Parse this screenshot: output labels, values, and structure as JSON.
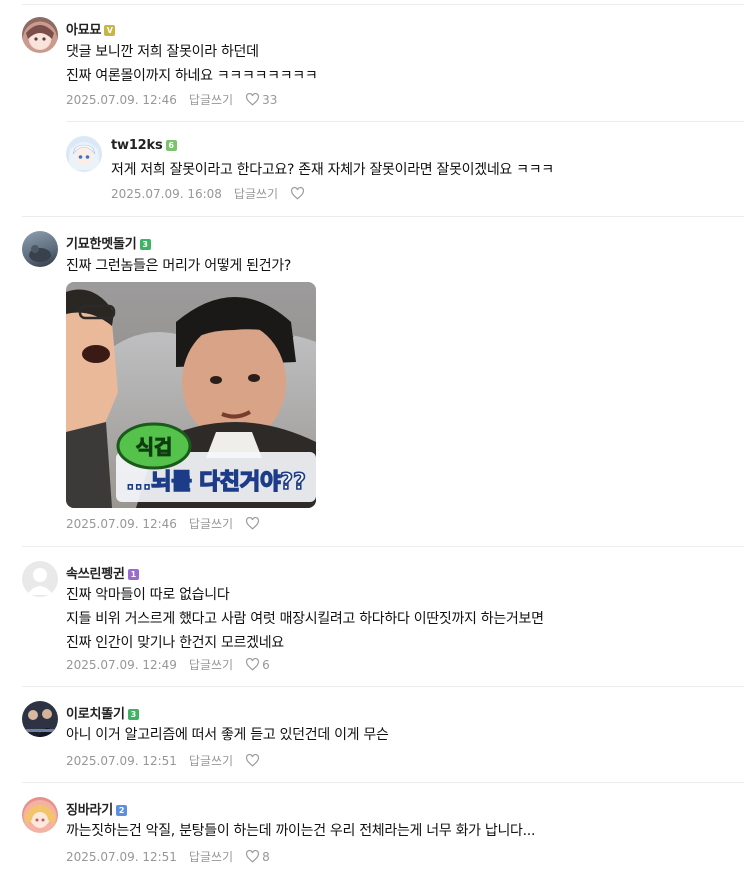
{
  "comments": [
    {
      "nickname": "아묘묘",
      "badge": "V",
      "lines": [
        "댓글 보니깐 저희 잘못이라 하던데",
        "진짜 여론몰이까지 하네요 ㅋㅋㅋㅋㅋㅋㅋㅋ"
      ],
      "date": "2025.07.09. 12:46",
      "reply_label": "답글쓰기",
      "likes": "33"
    },
    {
      "nickname": "tw12ks",
      "badge": "6",
      "lines": [
        "저게 저희 잘못이라고 한다고요? 존재 자체가 잘못이라면 잘못이겠네요 ㅋㅋㅋ"
      ],
      "date": "2025.07.09. 16:08",
      "reply_label": "답글쓰기",
      "likes": ""
    },
    {
      "nickname": "기묘한멧돌기",
      "badge": "3",
      "lines": [
        "진짜 그런놈들은 머리가 어떻게 된건가?"
      ],
      "sticker_text_1": "식겁",
      "sticker_text_2": "...뇌를 다친거야??",
      "date": "2025.07.09. 12:46",
      "reply_label": "답글쓰기",
      "likes": ""
    },
    {
      "nickname": "속쓰린펭귄",
      "badge": "1",
      "lines": [
        "진짜 악마들이 따로 없습니다",
        "지들 비위 거스르게 했다고 사람 여럿 매장시킬려고 하다하다 이딴짓까지 하는거보면",
        "진짜 인간이 맞기나 한건지 모르겠네요"
      ],
      "date": "2025.07.09. 12:49",
      "reply_label": "답글쓰기",
      "likes": "6"
    },
    {
      "nickname": "이로치똘기",
      "badge": "3",
      "lines": [
        "아니 이거 알고리즘에 떠서 좋게 듣고 있던건데 이게 무슨"
      ],
      "date": "2025.07.09. 12:51",
      "reply_label": "답글쓰기",
      "likes": ""
    },
    {
      "nickname": "징바라기",
      "badge": "2",
      "lines": [
        "까는짓하는건 악질, 분탕들이 하는데 까이는건 우리 전체라는게 너무 화가 납니다..."
      ],
      "date": "2025.07.09. 12:51",
      "reply_label": "답글쓰기",
      "likes": "8"
    }
  ],
  "colors": {
    "badge_v": "#c8b642",
    "badge_6": "#7cc46b",
    "badge_3": "#3db463",
    "badge_1": "#9b6ad1",
    "badge_2": "#5b8fe0",
    "meta": "#979797"
  }
}
